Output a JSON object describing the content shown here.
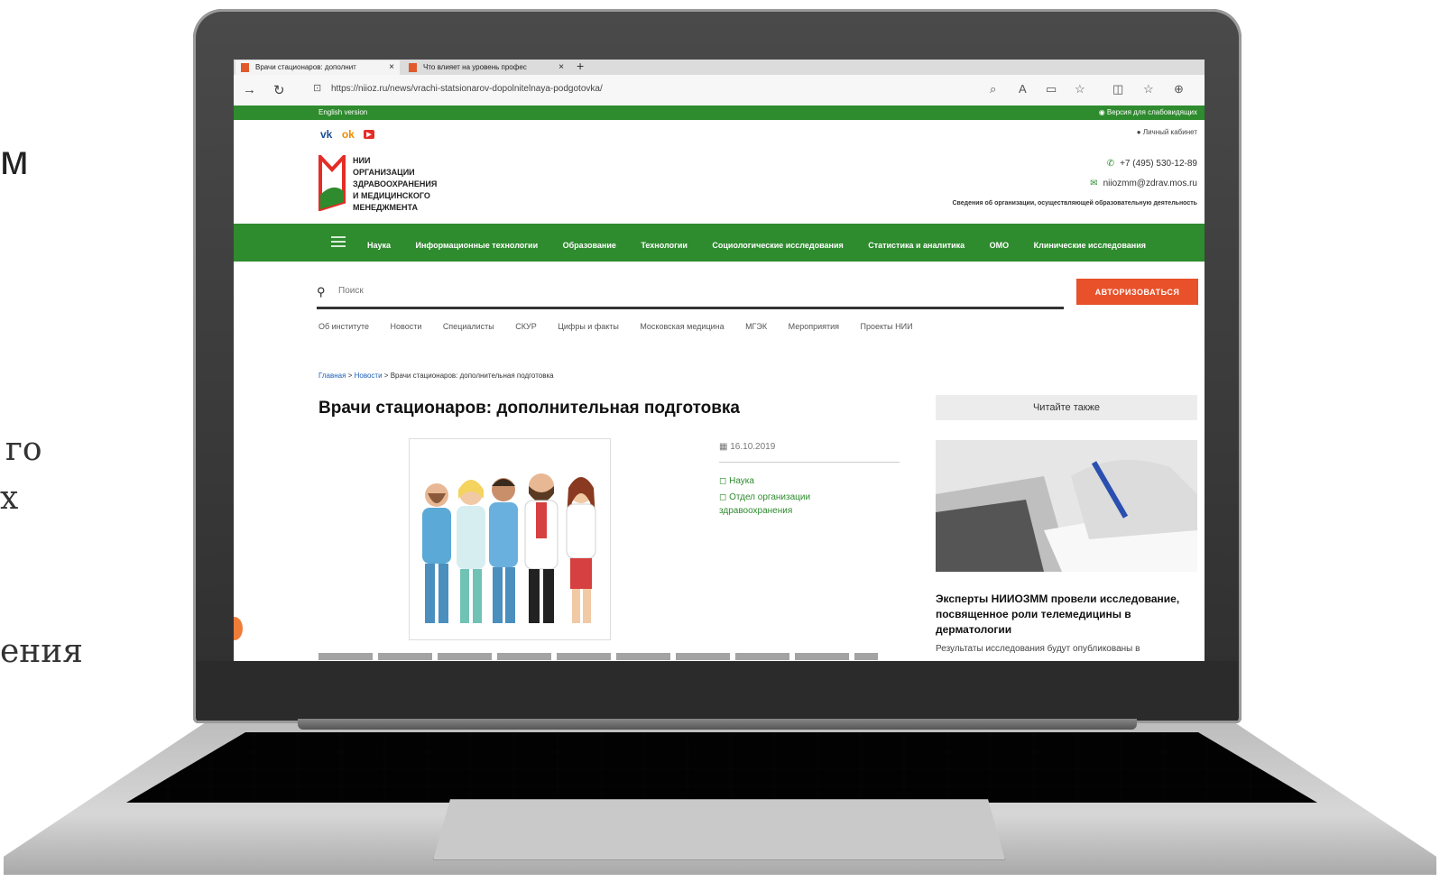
{
  "fragments": [
    "м",
    "го",
    "х",
    "ения"
  ],
  "browser": {
    "tabs": [
      {
        "title": "Врачи стационаров: дополнит"
      },
      {
        "title": "Что влияет на уровень профес"
      }
    ],
    "close_glyph": "×",
    "new_tab_glyph": "+",
    "url": "https://niioz.ru/news/vrachi-statsionarov-dopolnitelnaya-podgotovka/"
  },
  "site": {
    "english_version": "English version",
    "impaired_version": "Версия для слабовидящих",
    "cabinet": "Личный кабинет",
    "logo_lines": [
      "НИИ",
      "ОРГАНИЗАЦИИ",
      "ЗДРАВООХРАНЕНИЯ",
      "И МЕДИЦИНСКОГО",
      "МЕНЕДЖМЕНТА"
    ],
    "phone": "+7 (495) 530-12-89",
    "email": "niiozmm@zdrav.mos.ru",
    "org_info": "Сведения об организации, осуществляющей образовательную деятельность",
    "main_nav": [
      "Наука",
      "Информационные технологии",
      "Образование",
      "Технологии",
      "Социологические исследования",
      "Статистика и аналитика",
      "ОМО",
      "Клинические исследования"
    ],
    "search_placeholder": "Поиск",
    "auth_button": "АВТОРИЗОВАТЬСЯ",
    "sub_nav": [
      "Об институте",
      "Новости",
      "Специалисты",
      "СКУР",
      "Цифры и факты",
      "Московская медицина",
      "МГЭК",
      "Мероприятия",
      "Проекты НИИ"
    ]
  },
  "breadcrumb": {
    "home": "Главная",
    "news": "Новости",
    "current": "Врачи стационаров: дополнительная подготовка",
    "sep": ">"
  },
  "article": {
    "title": "Врачи стационаров: дополнительная подготовка",
    "date": "16.10.2019",
    "tags": [
      "Наука",
      "Отдел организации здравоохранения"
    ]
  },
  "aside": {
    "title": "Читайте также",
    "headline": "Эксперты НИИОЗММ провели исследование, посвященное роли телемедицины в дерматологии",
    "excerpt": "Результаты исследования будут опубликованы в"
  },
  "colors": {
    "green": "#2e8b2e",
    "auth": "#e8512a",
    "logo_red": "#e52d27"
  }
}
